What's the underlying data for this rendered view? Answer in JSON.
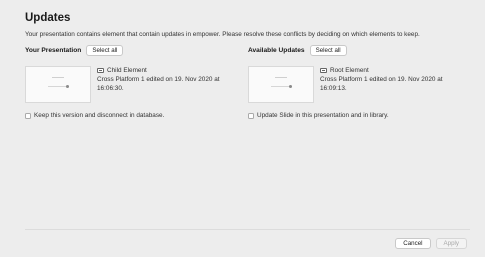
{
  "dialog": {
    "title": "Updates",
    "description": "Your presentation contains element that contain updates in empower. Please resolve these conflicts by deciding on which elements to keep."
  },
  "your_presentation": {
    "title": "Your Presentation",
    "select_all_label": "Select all",
    "element_icon": "element-icon",
    "element_name": "Child Element",
    "edited_text": "Cross Platform 1 edited on 19. Nov 2020 at 16:06:30.",
    "checkbox_label": "Keep this version and disconnect in database.",
    "checked": false
  },
  "available_updates": {
    "title": "Available Updates",
    "select_all_label": "Select all",
    "element_icon": "element-icon",
    "element_name": "Root Element",
    "edited_text": "Cross Platform 1 edited on 19. Nov 2020 at 16:09:13.",
    "checkbox_label": "Update Slide in this presentation and in library.",
    "checked": false
  },
  "footer": {
    "cancel_label": "Cancel",
    "apply_label": "Apply"
  }
}
